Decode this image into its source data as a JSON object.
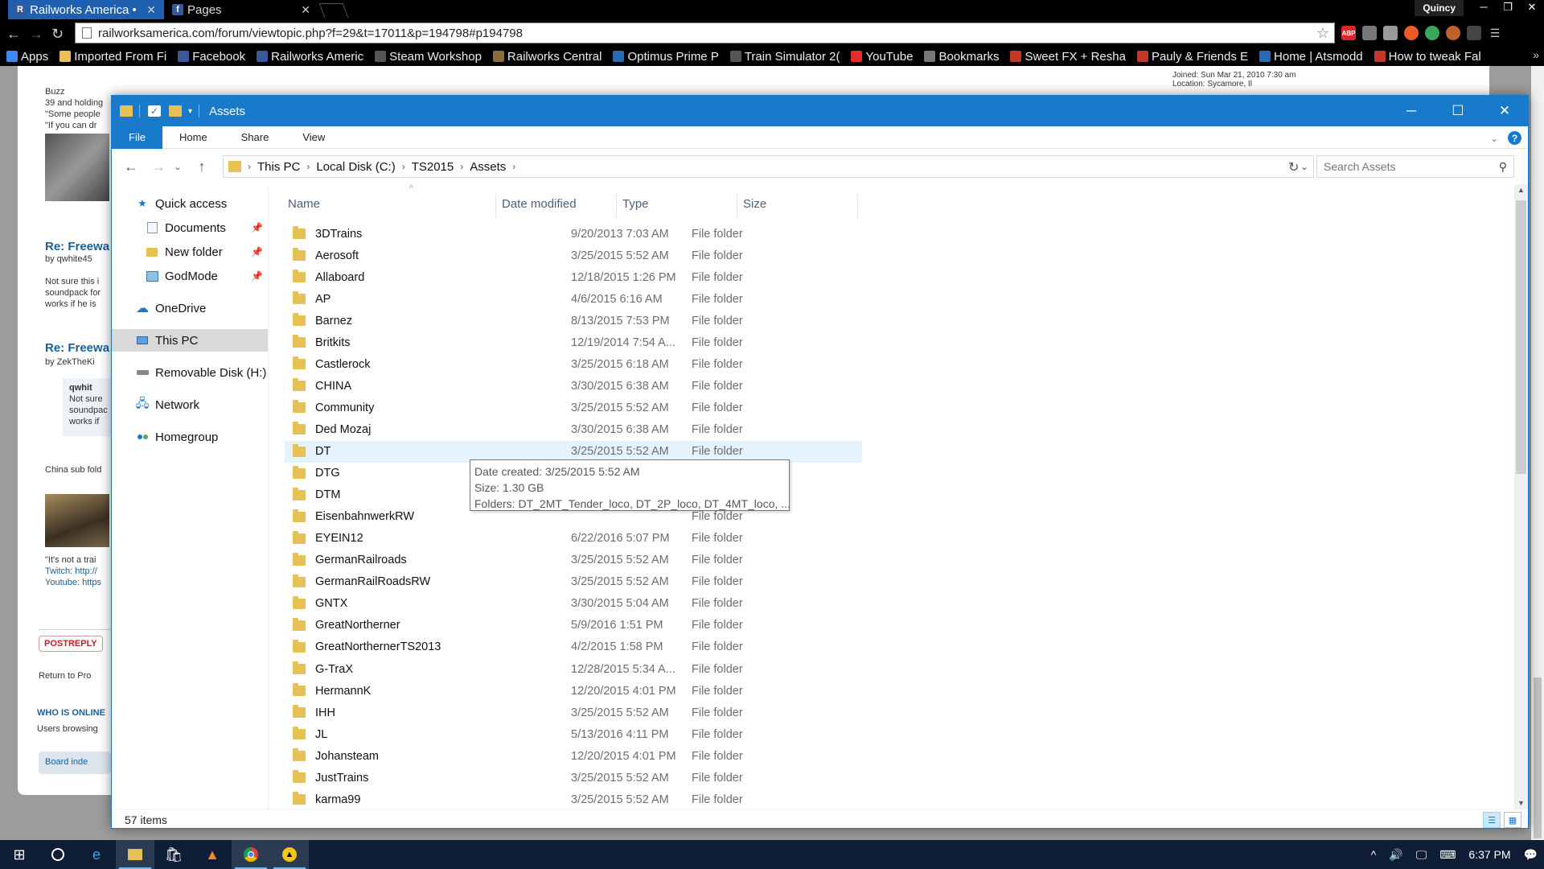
{
  "browser": {
    "tabs": [
      {
        "title": "Railworks America •",
        "favicon": "R",
        "active": true
      },
      {
        "title": "Pages",
        "favicon": "f",
        "active": false
      }
    ],
    "user": "Quincy",
    "url": "railworksamerica.com/forum/viewtopic.php?f=29&t=17011&p=194798#p194798",
    "bookmarks": [
      {
        "label": "Apps",
        "icon": "apps-grid-icon",
        "color": "#4285f4"
      },
      {
        "label": "Imported From Fi",
        "icon": "folder-icon",
        "color": "#e8c156"
      },
      {
        "label": "Facebook",
        "icon": "facebook-icon",
        "color": "#3b5998"
      },
      {
        "label": "Railworks Americ",
        "icon": "railworks-icon",
        "color": "#3b5998"
      },
      {
        "label": "Steam Workshop",
        "icon": "download-icon",
        "color": "#555"
      },
      {
        "label": "Railworks Central",
        "icon": "railworks-central-icon",
        "color": "#8a6d3b"
      },
      {
        "label": "Optimus Prime P",
        "icon": "optimus-icon",
        "color": "#2a6ab2"
      },
      {
        "label": "Train Simulator 2(",
        "icon": "train-sim-icon",
        "color": "#555"
      },
      {
        "label": "YouTube",
        "icon": "youtube-icon",
        "color": "#e52d27"
      },
      {
        "label": "Bookmarks",
        "icon": "star-icon",
        "color": "#777"
      },
      {
        "label": "Sweet FX + Resha",
        "icon": "rs-icon",
        "color": "#c0392b"
      },
      {
        "label": "Pauly & Friends E",
        "icon": "pauly-icon",
        "color": "#c0392b"
      },
      {
        "label": "Home | Atsmodd",
        "icon": "atsmod-icon",
        "color": "#2a6ab2"
      },
      {
        "label": "How to tweak Fal",
        "icon": "pc-icon",
        "color": "#c0392b"
      }
    ]
  },
  "forum": {
    "lines": [
      {
        "text": "Buzz",
        "x": 56,
        "y": 26
      },
      {
        "text": "39 and holding",
        "x": 56,
        "y": 40
      },
      {
        "text": "\"Some people",
        "x": 56,
        "y": 54
      },
      {
        "text": "\"If you can dr",
        "x": 56,
        "y": 68
      }
    ],
    "heading1": "Re: Freewa",
    "byline1": "by qwhite45",
    "body1": [
      "Not sure this i",
      "soundpack for",
      "works if he is"
    ],
    "heading2": "Re: Freewa",
    "byline2": "by ZekTheKi",
    "quote": [
      "qwhit",
      "Not sure",
      "soundpac",
      "works if"
    ],
    "china": "China sub fold",
    "sig": [
      "\"It's not a trai",
      "Twitch: http://",
      "Youtube: https"
    ],
    "postreply": "POSTREPLY",
    "return": "Return to Pro",
    "whoisonline": "WHO IS ONLINE",
    "users": "Users browsing",
    "boardindex": "Board inde",
    "profile_joined": "Joined: Sun Mar 21, 2010 7:30 am",
    "profile_location": "Location: Sycamore, Il"
  },
  "explorer": {
    "title": "Assets",
    "ribbon_tabs": [
      "File",
      "Home",
      "Share",
      "View"
    ],
    "breadcrumbs": [
      "This PC",
      "Local Disk (C:)",
      "TS2015",
      "Assets"
    ],
    "search_placeholder": "Search Assets",
    "nav": {
      "quick_access": "Quick access",
      "pinned": [
        "Documents",
        "New folder",
        "GodMode"
      ],
      "onedrive": "OneDrive",
      "this_pc": "This PC",
      "removable": "Removable Disk (H:)",
      "network": "Network",
      "homegroup": "Homegroup"
    },
    "columns": {
      "name": "Name",
      "date": "Date modified",
      "type": "Type",
      "size": "Size"
    },
    "files": [
      {
        "name": "3DTrains",
        "date": "9/20/2013 7:03 AM",
        "type": "File folder"
      },
      {
        "name": "Aerosoft",
        "date": "3/25/2015 5:52 AM",
        "type": "File folder"
      },
      {
        "name": "Allaboard",
        "date": "12/18/2015 1:26 PM",
        "type": "File folder"
      },
      {
        "name": "AP",
        "date": "4/6/2015 6:16 AM",
        "type": "File folder"
      },
      {
        "name": "Barnez",
        "date": "8/13/2015 7:53 PM",
        "type": "File folder"
      },
      {
        "name": "Britkits",
        "date": "12/19/2014 7:54 A...",
        "type": "File folder"
      },
      {
        "name": "Castlerock",
        "date": "3/25/2015 6:18 AM",
        "type": "File folder"
      },
      {
        "name": "CHINA",
        "date": "3/30/2015 6:38 AM",
        "type": "File folder"
      },
      {
        "name": "Community",
        "date": "3/25/2015 5:52 AM",
        "type": "File folder"
      },
      {
        "name": "Ded Mozaj",
        "date": "3/30/2015 6:38 AM",
        "type": "File folder"
      },
      {
        "name": "DT",
        "date": "3/25/2015 5:52 AM",
        "type": "File folder",
        "hovered": true
      },
      {
        "name": "DTG",
        "date": "",
        "type": ""
      },
      {
        "name": "DTM",
        "date": "",
        "type": ""
      },
      {
        "name": "EisenbahnwerkRW",
        "date": "",
        "type": "File folder"
      },
      {
        "name": "EYEIN12",
        "date": "6/22/2016 5:07 PM",
        "type": "File folder"
      },
      {
        "name": "GermanRailroads",
        "date": "3/25/2015 5:52 AM",
        "type": "File folder"
      },
      {
        "name": "GermanRailRoadsRW",
        "date": "3/25/2015 5:52 AM",
        "type": "File folder"
      },
      {
        "name": "GNTX",
        "date": "3/30/2015 5:04 AM",
        "type": "File folder"
      },
      {
        "name": "GreatNortherner",
        "date": "5/9/2016 1:51 PM",
        "type": "File folder"
      },
      {
        "name": "GreatNorthernerTS2013",
        "date": "4/2/2015 1:58 PM",
        "type": "File folder"
      },
      {
        "name": "G-TraX",
        "date": "12/28/2015 5:34 A...",
        "type": "File folder"
      },
      {
        "name": "HermannK",
        "date": "12/20/2015 4:01 PM",
        "type": "File folder"
      },
      {
        "name": "IHH",
        "date": "3/25/2015 5:52 AM",
        "type": "File folder"
      },
      {
        "name": "JL",
        "date": "5/13/2016 4:11 PM",
        "type": "File folder"
      },
      {
        "name": "Johansteam",
        "date": "12/20/2015 4:01 PM",
        "type": "File folder"
      },
      {
        "name": "JustTrains",
        "date": "3/25/2015 5:52 AM",
        "type": "File folder"
      },
      {
        "name": "karma99",
        "date": "3/25/2015 5:52 AM",
        "type": "File folder"
      }
    ],
    "tooltip": {
      "created": "Date created: 3/25/2015 5:52 AM",
      "size": "Size: 1.30 GB",
      "folders": "Folders: DT_2MT_Tender_loco, DT_2P_loco, DT_4MT_loco, ..."
    },
    "status_count": "57 items"
  },
  "taskbar": {
    "clock": "6:37 PM"
  }
}
